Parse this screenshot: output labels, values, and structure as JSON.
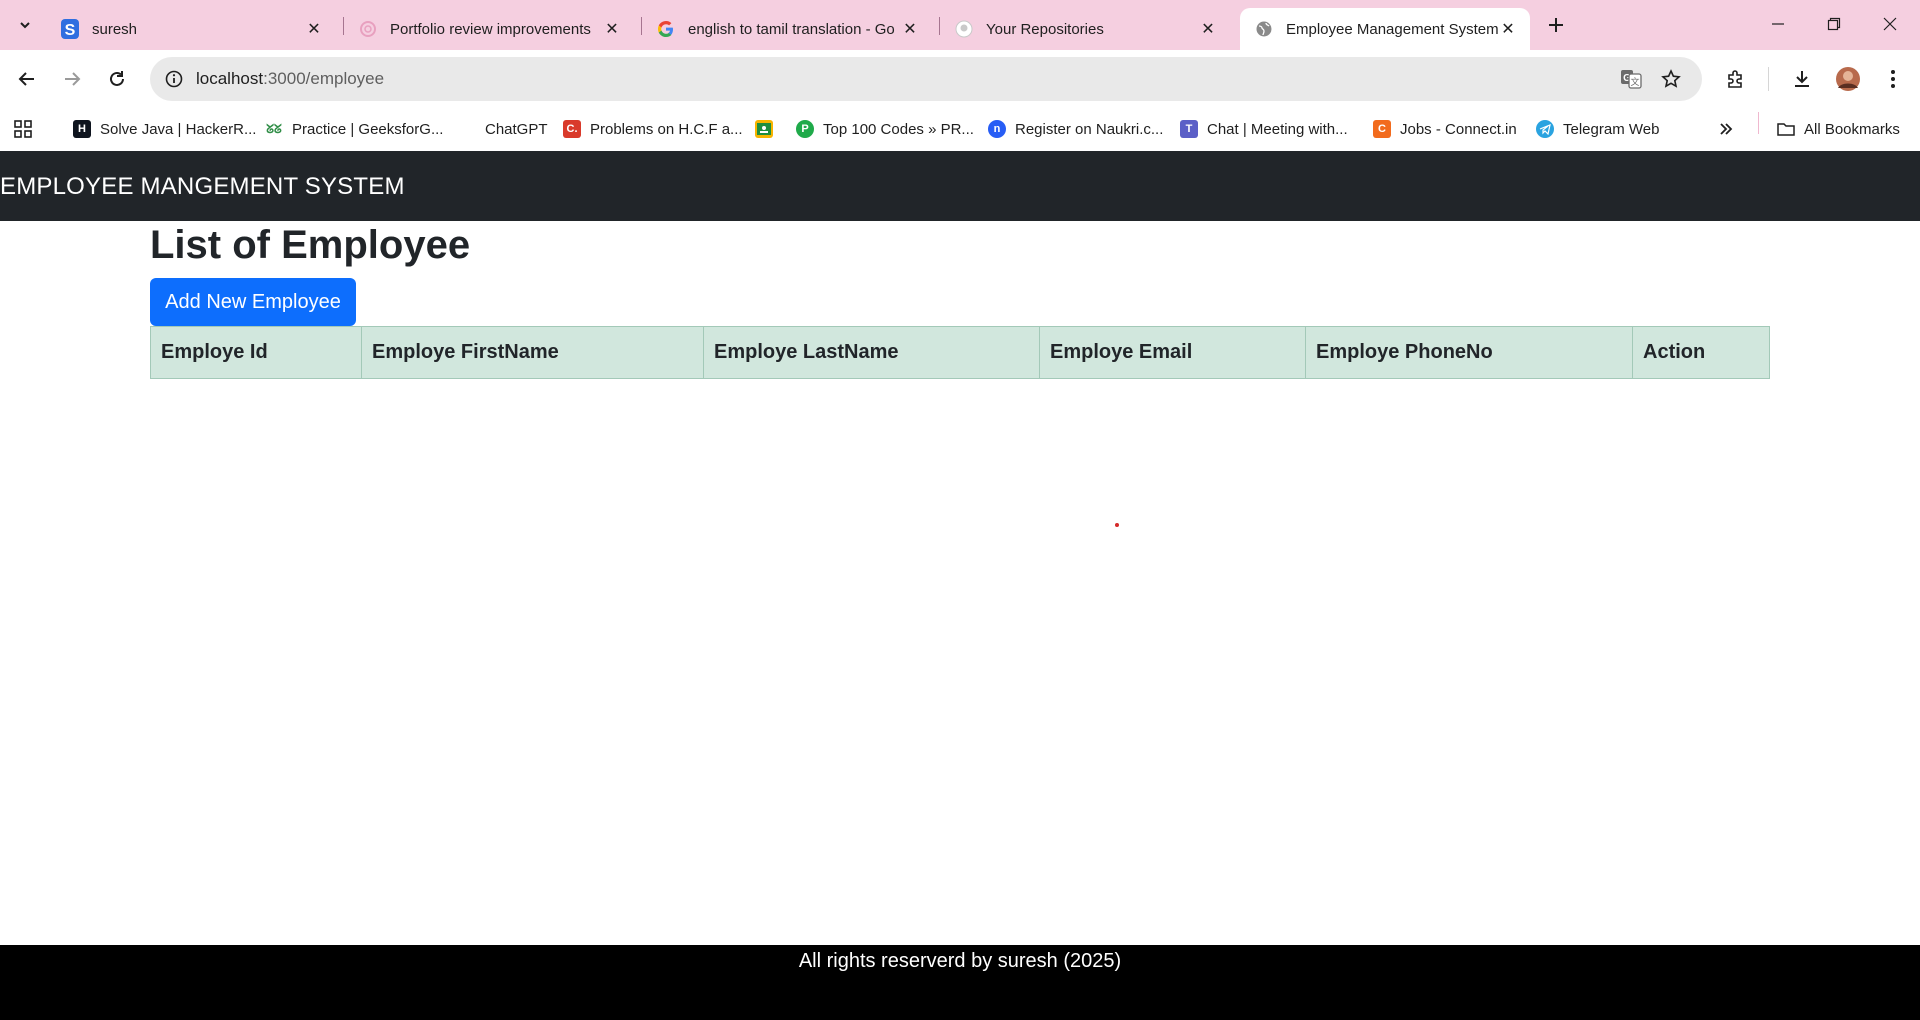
{
  "browser": {
    "tabs": [
      {
        "title": "suresh",
        "icon": "s-logo-icon"
      },
      {
        "title": "Portfolio review improvements",
        "icon": "chatgpt-icon"
      },
      {
        "title": "english to tamil translation - Go",
        "icon": "google-icon"
      },
      {
        "title": "Your Repositories",
        "icon": "github-icon"
      },
      {
        "title": "Employee Management System",
        "icon": "globe-icon",
        "active": true
      }
    ],
    "url_host": "localhost",
    "url_path": ":3000/employee",
    "bookmarks": [
      {
        "label": "Solve Java | HackerR...",
        "icon": "hackerrank-icon"
      },
      {
        "label": "Practice | GeeksforG...",
        "icon": "geeksforgeeks-icon"
      },
      {
        "label": "ChatGPT",
        "icon": "chatgpt-icon"
      },
      {
        "label": "Problems on H.C.F a...",
        "icon": "c-logo-icon"
      },
      {
        "label": "",
        "icon": "classroom-icon"
      },
      {
        "label": "Top 100 Codes » PR...",
        "icon": "prepinsta-icon"
      },
      {
        "label": "Register on Naukri.c...",
        "icon": "naukri-icon"
      },
      {
        "label": "Chat | Meeting with...",
        "icon": "teams-icon"
      },
      {
        "label": "Jobs - Connect.in",
        "icon": "connect-icon"
      },
      {
        "label": "Telegram Web",
        "icon": "telegram-icon"
      }
    ],
    "all_bookmarks": "All Bookmarks"
  },
  "app": {
    "brand": "EMPLOYEE MANGEMENT SYSTEM",
    "heading": "List of Employee",
    "add_button": "Add New Employee",
    "table_headers": [
      "Employe Id",
      "Employe FirstName",
      "Employe LastName",
      "Employe Email",
      "Employe PhoneNo",
      "Action"
    ],
    "footer": "All rights reserverd by suresh (2025)"
  },
  "colors": {
    "tabstrip": "#f5cfe0",
    "navbar": "#212529",
    "primary_button": "#0d6efd",
    "table_header": "#d1e7dd",
    "footer": "#000000"
  }
}
